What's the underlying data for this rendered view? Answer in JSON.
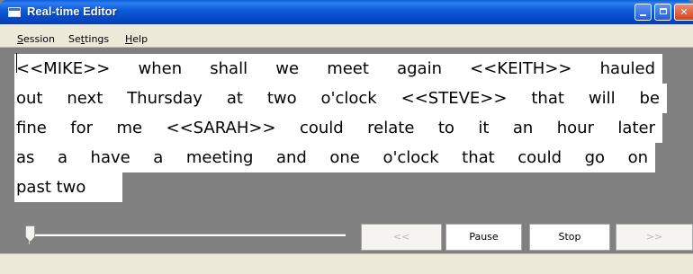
{
  "window": {
    "title": "Real-time Editor",
    "icon": "app-window-icon",
    "controls": [
      "minimize-icon",
      "maximize-icon",
      "close-icon"
    ]
  },
  "menu": {
    "items": [
      {
        "label": "Session",
        "underline": "S"
      },
      {
        "label": "Settings",
        "underline": "t"
      },
      {
        "label": "Help",
        "underline": "H"
      }
    ]
  },
  "editor": {
    "lines": [
      [
        "<<MIKE>>",
        "when",
        "shall",
        "we",
        "meet",
        "again",
        "<<KEITH>>",
        "hauled"
      ],
      [
        "out",
        "next",
        "Thursday",
        "at",
        "two",
        "o'clock",
        "<<STEVE>>",
        "that",
        "will",
        "be"
      ],
      [
        "fine",
        "for",
        "me",
        "<<SARAH>>",
        "could",
        "relate",
        "to",
        "it",
        "an",
        "hour",
        "later"
      ],
      [
        "as",
        "a",
        "have",
        "a",
        "meeting",
        "and",
        "one",
        "o'clock",
        "that",
        "could",
        "go",
        "on"
      ],
      [
        "past",
        "two"
      ]
    ]
  },
  "controls": {
    "prev_label": "<<",
    "pause_label": "Pause",
    "stop_label": "Stop",
    "next_label": ">>",
    "slider_position": 0
  },
  "colors": {
    "titlebar": "#0a58d6",
    "workspace": "#808080",
    "chrome": "#ece9d8"
  }
}
